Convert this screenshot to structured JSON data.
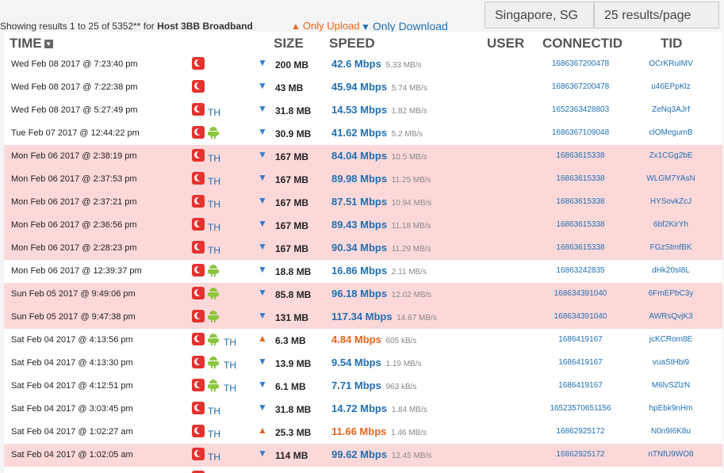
{
  "summary": {
    "prefix": "Showing results 1 to 25 of 5352** for ",
    "host": "Host 3BB Broadband"
  },
  "filters": {
    "upload": "Only Upload",
    "download": "Only Download"
  },
  "controls": {
    "location": "Singapore, SG",
    "per_page": "25 results/page"
  },
  "columns": {
    "time": "TIME",
    "size": "SIZE",
    "speed": "SPEED",
    "user": "USER",
    "connectid": "CONNECTID",
    "tid": "TID"
  },
  "colors": {
    "pink_row": "#fcd8d9",
    "download": "#1f6fb2",
    "upload": "#e8651c"
  },
  "rows": [
    {
      "time": "Wed Feb 08 2017 @ 7:23:40 pm",
      "country": "",
      "android": false,
      "direction": "down",
      "size": "200 MB",
      "mbps": "42.6 Mbps",
      "rate": "5.33 MB/s",
      "connectid": "1686367200478",
      "tid": "OCrKRuIMV",
      "highlight": false
    },
    {
      "time": "Wed Feb 08 2017 @ 7:22:38 pm",
      "country": "",
      "android": false,
      "direction": "down",
      "size": "43 MB",
      "mbps": "45.94 Mbps",
      "rate": "5.74 MB/s",
      "connectid": "1686367200478",
      "tid": "u46EPpKlz",
      "highlight": false
    },
    {
      "time": "Wed Feb 08 2017 @ 5:27:49 pm",
      "country": "TH",
      "android": false,
      "direction": "down",
      "size": "31.8 MB",
      "mbps": "14.53 Mbps",
      "rate": "1.82 MB/s",
      "connectid": "1652363428803",
      "tid": "ZeNq3AJrf",
      "highlight": false
    },
    {
      "time": "Tue Feb 07 2017 @ 12:44:22 pm",
      "country": "",
      "android": true,
      "direction": "down",
      "size": "30.9 MB",
      "mbps": "41.62 Mbps",
      "rate": "5.2 MB/s",
      "connectid": "1686367109048",
      "tid": "clOMegumB",
      "highlight": false
    },
    {
      "time": "Mon Feb 06 2017 @ 2:38:19 pm",
      "country": "TH",
      "android": false,
      "direction": "down",
      "size": "167 MB",
      "mbps": "84.04 Mbps",
      "rate": "10.5 MB/s",
      "connectid": "16863615338",
      "tid": "Zx1CGg2bE",
      "highlight": true
    },
    {
      "time": "Mon Feb 06 2017 @ 2:37:53 pm",
      "country": "TH",
      "android": false,
      "direction": "down",
      "size": "167 MB",
      "mbps": "89.98 Mbps",
      "rate": "11.25 MB/s",
      "connectid": "16863615338",
      "tid": "WLGM7YAsN",
      "highlight": true
    },
    {
      "time": "Mon Feb 06 2017 @ 2:37:21 pm",
      "country": "TH",
      "android": false,
      "direction": "down",
      "size": "167 MB",
      "mbps": "87.51 Mbps",
      "rate": "10.94 MB/s",
      "connectid": "16863615338",
      "tid": "HYSovkZcJ",
      "highlight": true
    },
    {
      "time": "Mon Feb 06 2017 @ 2:36:56 pm",
      "country": "TH",
      "android": false,
      "direction": "down",
      "size": "167 MB",
      "mbps": "89.43 Mbps",
      "rate": "11.18 MB/s",
      "connectid": "16863615338",
      "tid": "6bf2KirYh",
      "highlight": true
    },
    {
      "time": "Mon Feb 06 2017 @ 2:28:23 pm",
      "country": "TH",
      "android": false,
      "direction": "down",
      "size": "167 MB",
      "mbps": "90.34 Mbps",
      "rate": "11.29 MB/s",
      "connectid": "16863615338",
      "tid": "FGzStmfBK",
      "highlight": true
    },
    {
      "time": "Mon Feb 06 2017 @ 12:39:37 pm",
      "country": "",
      "android": true,
      "direction": "down",
      "size": "18.8 MB",
      "mbps": "16.86 Mbps",
      "rate": "2.11 MB/s",
      "connectid": "16863242835",
      "tid": "dHk20sI8L",
      "highlight": false
    },
    {
      "time": "Sun Feb 05 2017 @ 9:49:06 pm",
      "country": "",
      "android": true,
      "direction": "down",
      "size": "85.8 MB",
      "mbps": "96.18 Mbps",
      "rate": "12.02 MB/s",
      "connectid": "168634391040",
      "tid": "6FmEPbC3y",
      "highlight": true
    },
    {
      "time": "Sun Feb 05 2017 @ 9:47:38 pm",
      "country": "",
      "android": true,
      "direction": "down",
      "size": "131 MB",
      "mbps": "117.34 Mbps",
      "rate": "14.67 MB/s",
      "connectid": "168634391040",
      "tid": "AWRsQvjK3",
      "highlight": true
    },
    {
      "time": "Sat Feb 04 2017 @ 4:13:56 pm",
      "country": "TH",
      "android": true,
      "direction": "up",
      "size": "6.3 MB",
      "mbps": "4.84 Mbps",
      "rate": "605 kB/s",
      "connectid": "1686419167",
      "tid": "jcKCRom8E",
      "highlight": false
    },
    {
      "time": "Sat Feb 04 2017 @ 4:13:30 pm",
      "country": "TH",
      "android": true,
      "direction": "down",
      "size": "13.9 MB",
      "mbps": "9.54 Mbps",
      "rate": "1.19 MB/s",
      "connectid": "1686419167",
      "tid": "vuaStHbi9",
      "highlight": false
    },
    {
      "time": "Sat Feb 04 2017 @ 4:12:51 pm",
      "country": "TH",
      "android": true,
      "direction": "down",
      "size": "6.1 MB",
      "mbps": "7.71 Mbps",
      "rate": "963 kB/s",
      "connectid": "1686419167",
      "tid": "M6lvSZlzN",
      "highlight": false
    },
    {
      "time": "Sat Feb 04 2017 @ 3:03:45 pm",
      "country": "TH",
      "android": false,
      "direction": "down",
      "size": "31.8 MB",
      "mbps": "14.72 Mbps",
      "rate": "1.84 MB/s",
      "connectid": "16523570651156",
      "tid": "hpEbk9nHm",
      "highlight": false
    },
    {
      "time": "Sat Feb 04 2017 @ 1:02:27 am",
      "country": "TH",
      "android": false,
      "direction": "up",
      "size": "25.3 MB",
      "mbps": "11.66 Mbps",
      "rate": "1.46 MB/s",
      "connectid": "16862925172",
      "tid": "N0n9I6K8u",
      "highlight": false
    },
    {
      "time": "Sat Feb 04 2017 @ 1:02:05 am",
      "country": "TH",
      "android": false,
      "direction": "down",
      "size": "114 MB",
      "mbps": "99.62 Mbps",
      "rate": "12.45 MB/s",
      "connectid": "16862925172",
      "tid": "nTNfU9WO8",
      "highlight": true
    },
    {
      "time": "",
      "country": "",
      "android": false,
      "direction": "up",
      "size": "",
      "mbps": "",
      "rate": "",
      "connectid": "",
      "tid": "",
      "highlight": false
    }
  ]
}
